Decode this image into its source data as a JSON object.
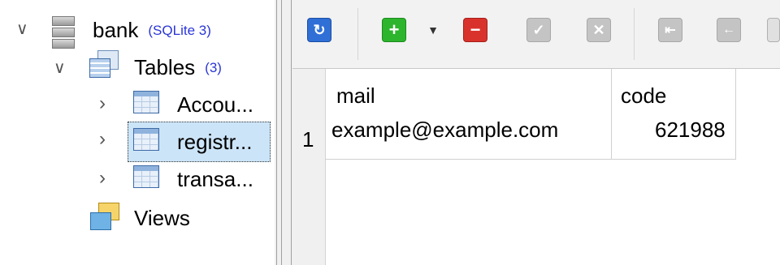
{
  "tree": {
    "database": {
      "name": "bank",
      "type": "(SQLite 3)"
    },
    "tables_folder": {
      "label": "Tables",
      "count": "(3)"
    },
    "tables": [
      {
        "label": "Accou..."
      },
      {
        "label": "registr..."
      },
      {
        "label": "transa..."
      }
    ],
    "views": {
      "label": "Views"
    }
  },
  "toolbar": {
    "buttons": [
      {
        "icon": "refresh-icon",
        "color": "#2f6fd6"
      },
      {
        "icon": "add-icon",
        "color": "#2db52d"
      },
      {
        "icon": "dropdown-arrow-icon"
      },
      {
        "icon": "delete-icon",
        "color": "#d9322c"
      },
      {
        "icon": "commit-icon",
        "color": "#b8b8b8"
      },
      {
        "icon": "rollback-icon",
        "color": "#b8b8b8"
      },
      {
        "icon": "first-page-icon",
        "color": "#b8b8b8"
      },
      {
        "icon": "previous-page-icon",
        "color": "#b8b8b8"
      }
    ]
  },
  "grid": {
    "columns": [
      "mail",
      "code"
    ],
    "rows": [
      {
        "row_number": "1",
        "mail": "example@example.com",
        "code": "621988"
      }
    ]
  }
}
